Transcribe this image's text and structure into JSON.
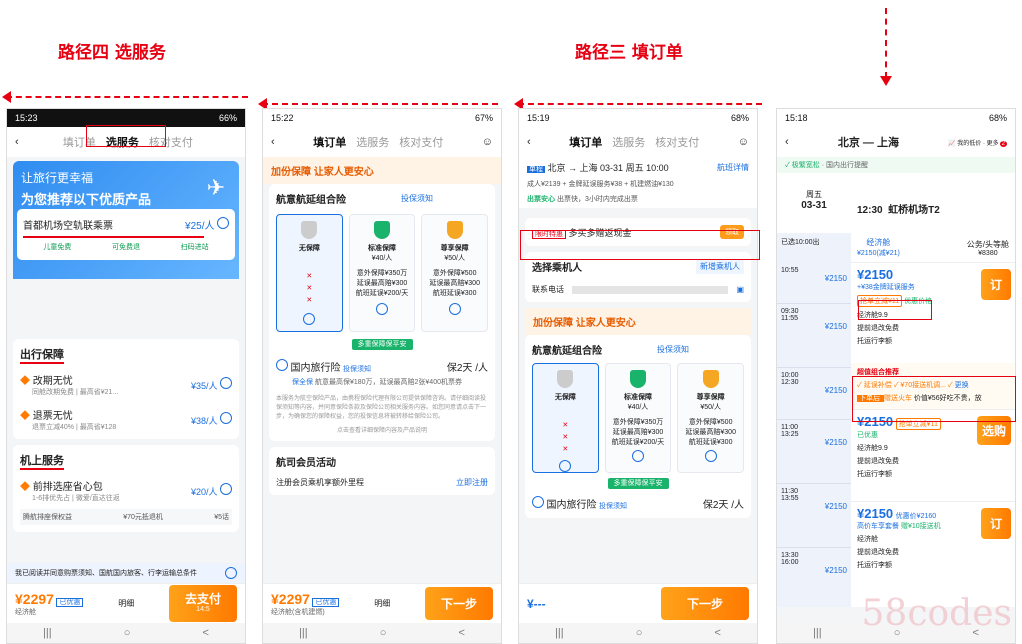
{
  "annotations": {
    "path4": "路径四 选服务",
    "path3": "路径三 填订单"
  },
  "phone1": {
    "status": {
      "time": "15:23",
      "battery": "66%"
    },
    "nav": {
      "step1": "填订单",
      "step2": "选服务",
      "step3": "核对支付"
    },
    "banner": {
      "line1": "让旅行更幸福",
      "line2": "为您推荐以下优质产品"
    },
    "rail": {
      "title": "首都机场空轨联乘票",
      "price": "¥25/人",
      "feat1": "儿童免费",
      "feat2": "可免费退",
      "feat3": "扫码进站"
    },
    "sec1": {
      "title": "出行保障"
    },
    "change": {
      "title": "改期无忧",
      "desc": "同舱改期免费 | 最高省¥21...",
      "price": "¥35/人"
    },
    "refund": {
      "title": "退票无忧",
      "desc": "退票立减40% | 最高省¥128",
      "price": "¥38/人"
    },
    "sec2": {
      "title": "机上服务"
    },
    "seat": {
      "title": "前排选座省心包",
      "desc": "1-6排优先占 | 微爱/直达往返",
      "price": "¥20/人",
      "p1": "腾航排座保权益",
      "p2": "¥70元抵退机",
      "p3": "¥5话"
    },
    "agree": "我已阅读并同意购票须知、国航国内旅客、行李运输总条件",
    "bottom": {
      "price": "¥2297",
      "discount": "已优惠",
      "sub": "经济舱",
      "detail": "明细",
      "pay": "去支付",
      "paysub": "14:5"
    },
    "sys": {
      "a": "|||",
      "b": "○",
      "c": "<"
    }
  },
  "phone2": {
    "status": {
      "time": "15:22",
      "battery": "67%"
    },
    "nav": {
      "step1": "填订单",
      "step2": "选服务",
      "step3": "核对支付"
    },
    "promo": "加份保障 让家人更安心",
    "ins": {
      "title": "航意航延组合险",
      "notice": "投保须知"
    },
    "plans": [
      {
        "name": "无保障",
        "price": ""
      },
      {
        "name": "标准保障",
        "price": "¥40/人",
        "l1": "意外保障¥350万",
        "l2": "延误最高赔¥300",
        "l3": "航班延误¥200/天"
      },
      {
        "name": "尊享保障",
        "price": "¥50/人",
        "l1": "意外保障¥500",
        "l2": "延误最高赔¥300",
        "l3": "航班延误¥300"
      }
    ],
    "badge": "多重保障保平安",
    "travel": {
      "title": "国内旅行险",
      "notice": "投保须知",
      "days": "保2天",
      "unit": "/人",
      "tag": "保全保",
      "desc": "航意最高保¥180万，延误最高赔2张¥400机票券"
    },
    "fine": "本服务为航空保险产品，由携程保险代理有限公司提供保障咨询。请仔细阅读投保须知等内容，并同意保险条款及保险公司相关服务内容。如您同意请点击下一步，为确保您的保障权益，您的投保信息将被转移给保险公司。",
    "fine2": "点击查看详细保障内容及产品说明",
    "member": {
      "title": "航司会员活动",
      "item": "注册会员乘机享额外里程",
      "link": "立即注册"
    },
    "bottom": {
      "price": "¥2297",
      "discount": "已优惠",
      "sub": "经济舱(含机建燃)",
      "detail": "明细",
      "next": "下一步"
    },
    "sys": {
      "a": "|||",
      "b": "○",
      "c": "<"
    }
  },
  "phone3": {
    "status": {
      "time": "15:19",
      "battery": "68%"
    },
    "nav": {
      "step1": "填订单",
      "step2": "选服务",
      "step3": "核对支付"
    },
    "flight": {
      "tag": "单程",
      "route": "北京 → 上海",
      "date": "03-31 周五 10:00",
      "detail": "航班详情",
      "price": "成人¥2139 + 金牌延误服务¥38 + 机建燃油¥130",
      "tag2": "出票安心",
      "tag2desc": "出票快，3小时内完成出票"
    },
    "bonus": {
      "tag": "限时特惠",
      "text": "多买多赠返现金",
      "btn": "领取"
    },
    "pax": {
      "title": "选择乘机人",
      "add": "新增乘机人",
      "phone": "联系电话"
    },
    "promo": "加份保障 让家人更安心",
    "ins": {
      "title": "航意航延组合险",
      "notice": "投保须知"
    },
    "plans": [
      {
        "name": "无保障",
        "price": ""
      },
      {
        "name": "标准保障",
        "price": "¥40/人",
        "l1": "意外保障¥350万",
        "l2": "延误最高赔¥300",
        "l3": "航班延误¥200/天"
      },
      {
        "name": "尊享保障",
        "price": "¥50/人",
        "l1": "意外保障¥500",
        "l2": "延误最高赔¥300",
        "l3": "航班延误¥300"
      }
    ],
    "badge": "多重保障保平安",
    "travel": {
      "title": "国内旅行险",
      "notice": "投保须知",
      "days": "保2天",
      "unit": "/人"
    },
    "bottom": {
      "price": "¥---",
      "next": "下一步"
    },
    "sys": {
      "a": "|||",
      "b": "○",
      "c": "<"
    }
  },
  "phone4": {
    "status": {
      "time": "15:18",
      "battery": "68%"
    },
    "nav": {
      "title": "北京 — 上海",
      "trend": "我的低价",
      "more": "更多",
      "badge": "2"
    },
    "notice": {
      "a": "✓ 极繁宽松",
      "b": "· 国内出行提醒"
    },
    "date": {
      "day": "周五",
      "date": "03-31"
    },
    "sel": {
      "time": "12:30",
      "airport": "虹桥机场T2"
    },
    "tabs": {
      "eco": "经济舱",
      "ecoPrice": "¥2150(减¥21)",
      "biz": "公务/头等舱",
      "bizPrice": "¥8380"
    },
    "left": [
      {
        "t1": "已选10:00出",
        "t2": "",
        "a": "",
        "p": ""
      },
      {
        "t1": "10:55",
        "t2": "",
        "a": "虹桥",
        "p": "¥2150"
      },
      {
        "t1": "09:30",
        "t2": "11:55",
        "a": "首都 / 虹桥",
        "p": "¥2150"
      },
      {
        "t1": "10:00",
        "t2": "12:30",
        "a": "首都 / 虹桥",
        "p": "¥2150"
      },
      {
        "t1": "11:00",
        "t2": "13:25",
        "a": "首都 / 虹桥",
        "p": "¥2150"
      },
      {
        "t1": "11:30",
        "t2": "13:55",
        "a": "首都 / 虹桥",
        "p": "¥2150"
      },
      {
        "t1": "13:30",
        "t2": "16:00",
        "a": "首都 / 虹桥",
        "p": "¥2150"
      }
    ],
    "opt1": {
      "price": "¥2150",
      "sub": "+¥38金牌延误服务",
      "tag": "抢单立减¥11",
      "sub2": "优惠价格",
      "l1": "经济舱9.9",
      "l2": "提前退改免费",
      "l3": "托运行李额",
      "btn": "订"
    },
    "combo": {
      "title": "超值组合推荐",
      "a": "✓ 延误补偿",
      "b": "✓ ¥70接送机调...",
      "c": "✓",
      "d": "更换",
      "e": "下单后 ",
      "f": "赠送火车 ",
      "g": "价值¥56好吃不贵，放"
    },
    "opt2": {
      "price": "¥2150",
      "tag": "抢单立减¥11",
      "sub": "已优惠",
      "l1": "经济舱9.9",
      "l2": "提前退改免费",
      "l3": "托运行李额",
      "btn": "选购"
    },
    "opt3": {
      "price": "¥2150",
      "tag": "优惠价¥2160",
      "sub": "高价车享套餐",
      "sub2": "赠¥10接送机",
      "l1": "经济舱",
      "l2": "提前退改免费",
      "l3": "托运行李额",
      "btn": "订"
    },
    "sys": {
      "a": "|||",
      "b": "○",
      "c": "<"
    }
  },
  "watermark": "58codes",
  "colors": {
    "red": "#e60012",
    "blue": "#1a6fe0",
    "orange": "#ff7a00"
  }
}
